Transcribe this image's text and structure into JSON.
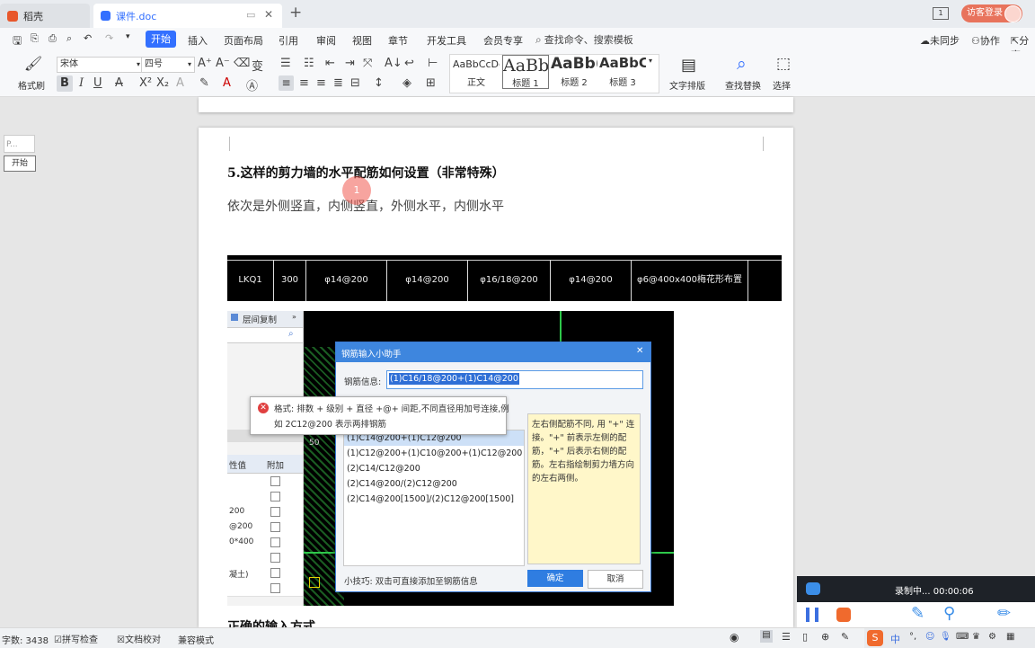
{
  "tabs": [
    {
      "label": "稻壳"
    },
    {
      "label": "课件.doc"
    }
  ],
  "window": {
    "login_label": "访客登录"
  },
  "menu": {
    "items": [
      "开始",
      "插入",
      "页面布局",
      "引用",
      "审阅",
      "视图",
      "章节",
      "开发工具",
      "会员专享"
    ],
    "search_placeholder": "查找命令、搜索模板",
    "right": [
      "未同步",
      "协作",
      "分享"
    ]
  },
  "ribbon": {
    "format_painter": "格式刷",
    "font": "宋体",
    "size": "四号",
    "styles": [
      {
        "preview": "AaBbCcDd",
        "label": "正文"
      },
      {
        "preview": "AaBb",
        "label": "标题 1"
      },
      {
        "preview": "AaBb(",
        "label": "标题 2"
      },
      {
        "preview": "AaBbC(",
        "label": "标题 3"
      }
    ],
    "text_layout": "文字排版",
    "find_replace": "查找替换",
    "select": "选择"
  },
  "nav_pane": {
    "thumb": "P...",
    "label": "开始"
  },
  "doc": {
    "heading": "5.这样的剪力墙的水平配筋如何设置（非常特殊）",
    "body": "依次是外侧竖直，内侧竖直，外侧水平，内侧水平",
    "cursor_marker": "1",
    "bottom_text": "正确的输入方式"
  },
  "cad_strip": [
    "LKQ1",
    "300",
    "φ14@200",
    "φ14@200",
    "φ16/18@200",
    "φ14@200",
    "φ6@400x400梅花形布置"
  ],
  "left_panel": {
    "title": "层间复制",
    "header_value": "性值",
    "header_attach": "附加",
    "rows": [
      "",
      "",
      "200",
      "@200",
      "0*400",
      "",
      "凝土)",
      ""
    ]
  },
  "dialog": {
    "title": "钢筋输入小助手",
    "field_label": "钢筋信息:",
    "field_value": "(1)C16/18@200+(1)C14@200",
    "list": [
      "(1)C14@200+(1)C12@200",
      "(1)C12@200+(1)C10@200+(1)C12@200",
      "(2)C14/C12@200",
      "(2)C14@200/(2)C12@200",
      "(2)C14@200[1500]/(2)C12@200[1500]"
    ],
    "hint": "左右侧配筋不同, 用 \"+\" 连接。\"+\" 前表示左侧的配筋，\"+\" 后表示右侧的配筋。左右指绘制剪力墙方向的左右两侧。",
    "tip": "小技巧: 双击可直接添加至钢筋信息",
    "ok": "确定",
    "cancel": "取消"
  },
  "tooltip": {
    "line1": "格式: 排数 + 级别 + 直径 +@+ 间距,不同直径用加号连接,例",
    "line2": "如 2C12@200 表示两排钢筋"
  },
  "recorder": {
    "status": "录制中... 00:00:06"
  },
  "statusbar": {
    "word_count": "字数: 3438",
    "spell_check": "拼写检查",
    "doc_proof": "文档校对",
    "compat": "兼容模式"
  },
  "ime": {
    "lang": "中"
  },
  "colors": {
    "accent": "#3370ff",
    "login": "#e8735c",
    "cad_green": "#2ec84a",
    "ok_button": "#2f7de1"
  }
}
